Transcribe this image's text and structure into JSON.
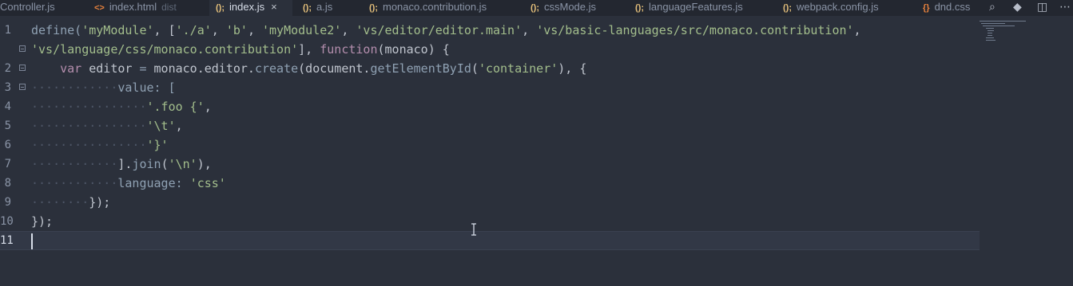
{
  "tabs": [
    {
      "icon": "",
      "label": "Controller.js",
      "sub": "",
      "active": false
    },
    {
      "icon": "<>",
      "label": "index.html",
      "sub": "dist",
      "active": false
    },
    {
      "icon": "();",
      "label": "index.js",
      "sub": "",
      "active": true,
      "close": "×"
    },
    {
      "icon": "();",
      "label": "a.js",
      "sub": "",
      "active": false
    },
    {
      "icon": "();",
      "label": "monaco.contribution.js",
      "sub": "",
      "active": false
    },
    {
      "icon": "();",
      "label": "cssMode.js",
      "sub": "",
      "active": false
    },
    {
      "icon": "();",
      "label": "languageFeatures.js",
      "sub": "",
      "active": false
    },
    {
      "icon": "();",
      "label": "webpack.config.js",
      "sub": "",
      "active": false
    },
    {
      "icon": "{}",
      "label": "dnd.css",
      "sub": "",
      "active": false
    }
  ],
  "toolbar_icons": [
    "find-references-icon",
    "git-icon",
    "split-editor-icon",
    "more-icon"
  ],
  "toolbar_glyphs": {
    "find": "⌕",
    "git": "◆",
    "split": "◫",
    "more": "⋯"
  },
  "colors": {
    "background": "#2b303b",
    "keyword": "#b48ead",
    "string": "#a3be8c",
    "function": "#8fa1b3",
    "text": "#c0c5ce"
  },
  "editor": {
    "line_numbers": [
      "1",
      "",
      "2",
      "3",
      "4",
      "5",
      "6",
      "7",
      "8",
      "9",
      "10",
      "11"
    ],
    "current_line": "11",
    "code": {
      "l1": {
        "a": "define(",
        "b": "'myModule'",
        "c": ", [",
        "d": "'./a'",
        "e": ", ",
        "f": "'b'",
        "g": ", ",
        "h": "'myModule2'",
        "i": ", ",
        "j": "'vs/editor/editor.main'",
        "k": ", ",
        "l": "'vs/basic-languages/src/monaco.contribution'",
        "m": ","
      },
      "l1b": {
        "a": "'vs/language/css/monaco.contribution'",
        "b": "], ",
        "c": "function",
        "d": "(monaco) {"
      },
      "l2": {
        "a": "    ",
        "b": "var",
        "c": " editor ",
        "d": "=",
        "e": " monaco.editor.",
        "f": "create",
        "g": "(document.",
        "h": "getElementById",
        "i": "(",
        "j": "'container'",
        "k": "), {"
      },
      "l3": {
        "a": "············",
        "b": "value: ["
      },
      "l4": {
        "a": "················",
        "b": "'.foo {'",
        "c": ","
      },
      "l5": {
        "a": "················",
        "b": "'\\t'",
        "c": ","
      },
      "l6": {
        "a": "················",
        "b": "'}'"
      },
      "l7": {
        "a": "············",
        "b": "].",
        "c": "join",
        "d": "(",
        "e": "'\\n'",
        "f": "),"
      },
      "l8": {
        "a": "············",
        "b": "language: ",
        "c": "'css'"
      },
      "l9": {
        "a": "········",
        "b": "});"
      },
      "l10": {
        "a": "});"
      }
    }
  }
}
